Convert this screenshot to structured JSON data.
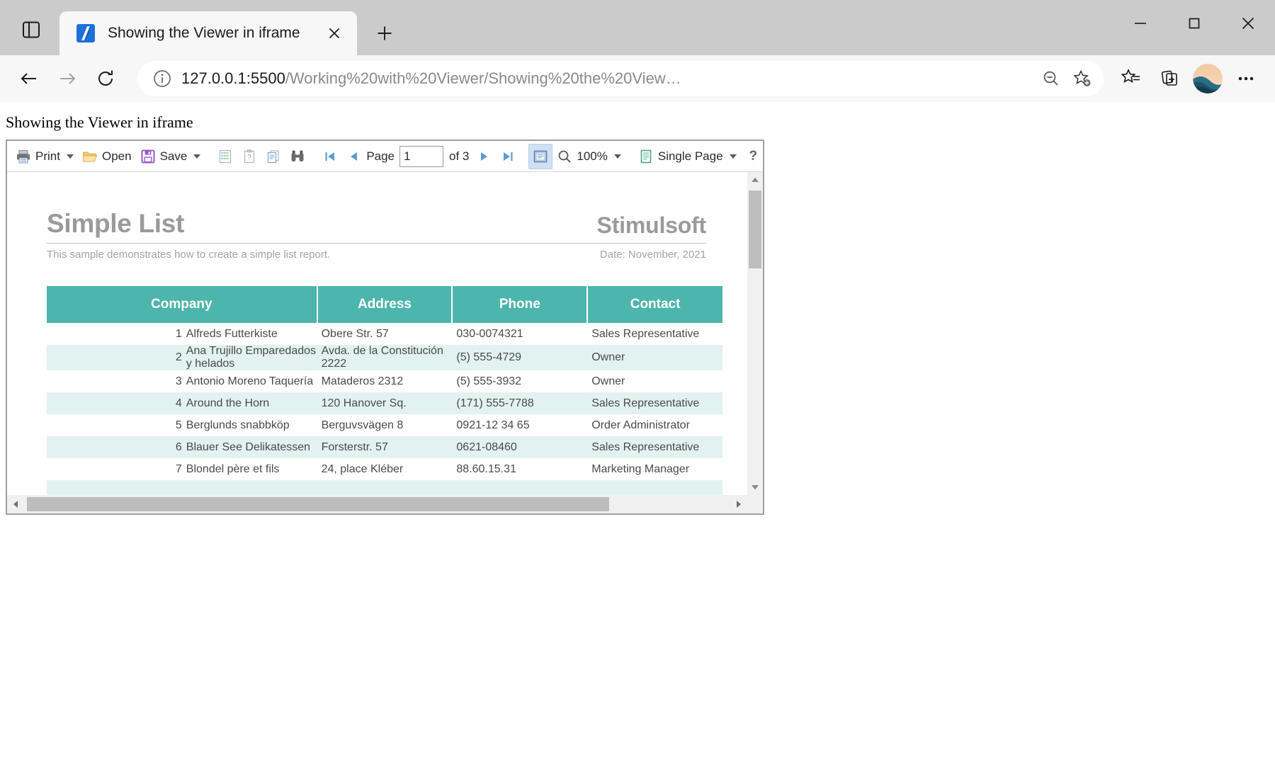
{
  "browser": {
    "window_title": "Showing the Viewer in iframe",
    "tab": {
      "title": "Showing the Viewer in iframe",
      "favicon": "live-server-icon",
      "close_label": "✕"
    },
    "new_tab_label": "+",
    "tab_actions_icon": "tab-actions-icon",
    "window_controls": {
      "minimize": "—",
      "maximize": "□",
      "close": "✕"
    },
    "nav": {
      "back": "back-arrow",
      "forward": "forward-arrow",
      "reload": "reload-icon"
    },
    "omnibox": {
      "info_icon": "site-info-icon",
      "url_host": "127.0.0.1:5500",
      "url_path": "/Working%20with%20Viewer/Showing%20the%20View…",
      "url_full": "127.0.0.1:5500/Working%20with%20Viewer/Showing%20the%20View…",
      "zoom_out_icon": "zoom-out-icon",
      "add_favorite_icon": "add-favorite-icon"
    },
    "toolbar_right": {
      "favorites": "favorites-icon",
      "collections": "collections-icon",
      "profile": "profile-avatar",
      "settings_more": "more-options-icon"
    }
  },
  "page": {
    "heading": "Showing the Viewer in iframe"
  },
  "viewer": {
    "toolbar": {
      "print": "Print",
      "open": "Open",
      "save": "Save",
      "bookmarks_icon": "bookmarks-icon",
      "parameters_icon": "parameters-icon",
      "resources_icon": "resources-icon",
      "find_icon": "find-binoculars-icon",
      "first_page_icon": "first-page-icon",
      "prev_page_icon": "previous-page-icon",
      "page_word": "Page",
      "page_value": "1",
      "of_label": "of 3",
      "next_page_icon": "next-page-icon",
      "last_page_icon": "last-page-icon",
      "fullscreen_icon": "full-page-view-icon",
      "zoom_icon": "zoom-magnifier-icon",
      "zoom_value": "100%",
      "view_mode_icon": "single-page-icon",
      "view_mode": "Single Page",
      "help": "?"
    },
    "report": {
      "title": "Simple List",
      "brand": "Stimulsoft",
      "subtitle": "This sample demonstrates how to create a simple list report.",
      "date": "Date: November, 2021",
      "columns": [
        "Company",
        "Address",
        "Phone",
        "Contact"
      ],
      "rows": [
        {
          "n": "1",
          "company": "Alfreds Futterkiste",
          "address": "Obere Str. 57",
          "phone": "030-0074321",
          "contact": "Sales Representative"
        },
        {
          "n": "2",
          "company": "Ana Trujillo Emparedados y helados",
          "address": "Avda. de la Constitución 2222",
          "phone": "(5) 555-4729",
          "contact": "Owner"
        },
        {
          "n": "3",
          "company": "Antonio Moreno Taquería",
          "address": "Mataderos  2312",
          "phone": "(5) 555-3932",
          "contact": "Owner"
        },
        {
          "n": "4",
          "company": "Around the Horn",
          "address": "120 Hanover Sq.",
          "phone": "(171) 555-7788",
          "contact": "Sales Representative"
        },
        {
          "n": "5",
          "company": "Berglunds snabbköp",
          "address": "Berguvsvägen  8",
          "phone": "0921-12 34 65",
          "contact": "Order Administrator"
        },
        {
          "n": "6",
          "company": "Blauer See Delikatessen",
          "address": "Forsterstr. 57",
          "phone": "0621-08460",
          "contact": "Sales Representative"
        },
        {
          "n": "7",
          "company": "Blondel père et fils",
          "address": "24, place Kléber",
          "phone": "88.60.15.31",
          "contact": "Marketing Manager"
        }
      ]
    },
    "colors": {
      "header_teal": "#4cb5ac",
      "alt_row": "#e2f2f0",
      "report_gray": "#9a9a9a"
    }
  }
}
